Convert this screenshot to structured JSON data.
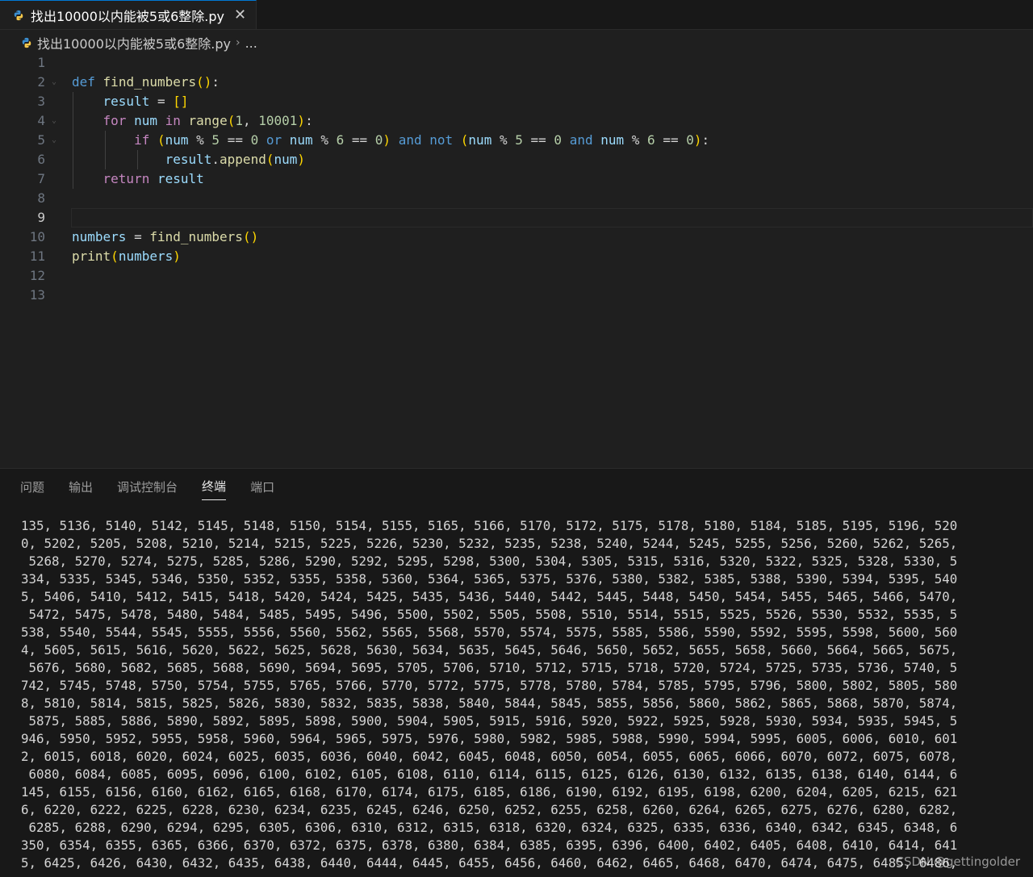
{
  "tab": {
    "filename": "找出10000以内能被5或6整除.py",
    "close_glyph": "✕"
  },
  "breadcrumb": {
    "file": "找出10000以内能被5或6整除.py",
    "sep": "›",
    "more": "..."
  },
  "editor": {
    "line_numbers": [
      "1",
      "2",
      "3",
      "4",
      "5",
      "6",
      "7",
      "8",
      "9",
      "10",
      "11",
      "12",
      "13"
    ]
  },
  "panel": {
    "tabs": [
      "问题",
      "输出",
      "调试控制台",
      "终端",
      "端口"
    ],
    "active_tab": "终端"
  },
  "terminal": {
    "lines": [
      "135, 5136, 5140, 5142, 5145, 5148, 5150, 5154, 5155, 5165, 5166, 5170, 5172, 5175, 5178, 5180, 5184, 5185, 5195, 5196, 520",
      "0, 5202, 5205, 5208, 5210, 5214, 5215, 5225, 5226, 5230, 5232, 5235, 5238, 5240, 5244, 5245, 5255, 5256, 5260, 5262, 5265,",
      " 5268, 5270, 5274, 5275, 5285, 5286, 5290, 5292, 5295, 5298, 5300, 5304, 5305, 5315, 5316, 5320, 5322, 5325, 5328, 5330, 5",
      "334, 5335, 5345, 5346, 5350, 5352, 5355, 5358, 5360, 5364, 5365, 5375, 5376, 5380, 5382, 5385, 5388, 5390, 5394, 5395, 540",
      "5, 5406, 5410, 5412, 5415, 5418, 5420, 5424, 5425, 5435, 5436, 5440, 5442, 5445, 5448, 5450, 5454, 5455, 5465, 5466, 5470,",
      " 5472, 5475, 5478, 5480, 5484, 5485, 5495, 5496, 5500, 5502, 5505, 5508, 5510, 5514, 5515, 5525, 5526, 5530, 5532, 5535, 5",
      "538, 5540, 5544, 5545, 5555, 5556, 5560, 5562, 5565, 5568, 5570, 5574, 5575, 5585, 5586, 5590, 5592, 5595, 5598, 5600, 560",
      "4, 5605, 5615, 5616, 5620, 5622, 5625, 5628, 5630, 5634, 5635, 5645, 5646, 5650, 5652, 5655, 5658, 5660, 5664, 5665, 5675,",
      " 5676, 5680, 5682, 5685, 5688, 5690, 5694, 5695, 5705, 5706, 5710, 5712, 5715, 5718, 5720, 5724, 5725, 5735, 5736, 5740, 5",
      "742, 5745, 5748, 5750, 5754, 5755, 5765, 5766, 5770, 5772, 5775, 5778, 5780, 5784, 5785, 5795, 5796, 5800, 5802, 5805, 580",
      "8, 5810, 5814, 5815, 5825, 5826, 5830, 5832, 5835, 5838, 5840, 5844, 5845, 5855, 5856, 5860, 5862, 5865, 5868, 5870, 5874,",
      " 5875, 5885, 5886, 5890, 5892, 5895, 5898, 5900, 5904, 5905, 5915, 5916, 5920, 5922, 5925, 5928, 5930, 5934, 5935, 5945, 5",
      "946, 5950, 5952, 5955, 5958, 5960, 5964, 5965, 5975, 5976, 5980, 5982, 5985, 5988, 5990, 5994, 5995, 6005, 6006, 6010, 601",
      "2, 6015, 6018, 6020, 6024, 6025, 6035, 6036, 6040, 6042, 6045, 6048, 6050, 6054, 6055, 6065, 6066, 6070, 6072, 6075, 6078,",
      " 6080, 6084, 6085, 6095, 6096, 6100, 6102, 6105, 6108, 6110, 6114, 6115, 6125, 6126, 6130, 6132, 6135, 6138, 6140, 6144, 6",
      "145, 6155, 6156, 6160, 6162, 6165, 6168, 6170, 6174, 6175, 6185, 6186, 6190, 6192, 6195, 6198, 6200, 6204, 6205, 6215, 621",
      "6, 6220, 6222, 6225, 6228, 6230, 6234, 6235, 6245, 6246, 6250, 6252, 6255, 6258, 6260, 6264, 6265, 6275, 6276, 6280, 6282,",
      " 6285, 6288, 6290, 6294, 6295, 6305, 6306, 6310, 6312, 6315, 6318, 6320, 6324, 6325, 6335, 6336, 6340, 6342, 6345, 6348, 6",
      "350, 6354, 6355, 6365, 6366, 6370, 6372, 6375, 6378, 6380, 6384, 6385, 6395, 6396, 6400, 6402, 6405, 6408, 6410, 6414, 641",
      "5, 6425, 6426, 6430, 6432, 6435, 6438, 6440, 6444, 6445, 6455, 6456, 6460, 6462, 6465, 6468, 6470, 6474, 6475, 6485, 6486,"
    ]
  },
  "watermark": "CSDN @gettingolder",
  "code": {
    "l2": {
      "def": "def",
      "name": "find_numbers",
      "parens": "()",
      "colon": ":"
    },
    "l3": {
      "var": "result",
      "eq": " = ",
      "list": "[]"
    },
    "l4": {
      "for": "for",
      "var": "num",
      "in": "in",
      "fn": "range",
      "open": "(",
      "a": "1",
      "comma": ", ",
      "b": "10001",
      "close": ")",
      "colon": ":"
    },
    "l5": {
      "if": "if",
      "p1": "(",
      "n1": "num",
      "m1": " % ",
      "v5": "5",
      "e1": " == ",
      "z1": "0",
      "or": "or",
      "n2": "num",
      "m2": " % ",
      "v6": "6",
      "e2": " == ",
      "z2": "0",
      "p1c": ")",
      "and1": "and",
      "not": "not",
      "p2": "(",
      "n3": "num",
      "m3": " % ",
      "v5b": "5",
      "e3": " == ",
      "z3": "0",
      "and2": "and",
      "n4": "num",
      "m4": " % ",
      "v6b": "6",
      "e4": " == ",
      "z4": "0",
      "p2c": ")",
      "colon": ":"
    },
    "l6": {
      "obj": "result",
      "dot": ".",
      "fn": "append",
      "open": "(",
      "arg": "num",
      "close": ")"
    },
    "l7": {
      "ret": "return",
      "var": "result"
    },
    "l10": {
      "var": "numbers",
      "eq": " = ",
      "fn": "find_numbers",
      "parens": "()"
    },
    "l11": {
      "fn": "print",
      "open": "(",
      "arg": "numbers",
      "close": ")"
    }
  }
}
